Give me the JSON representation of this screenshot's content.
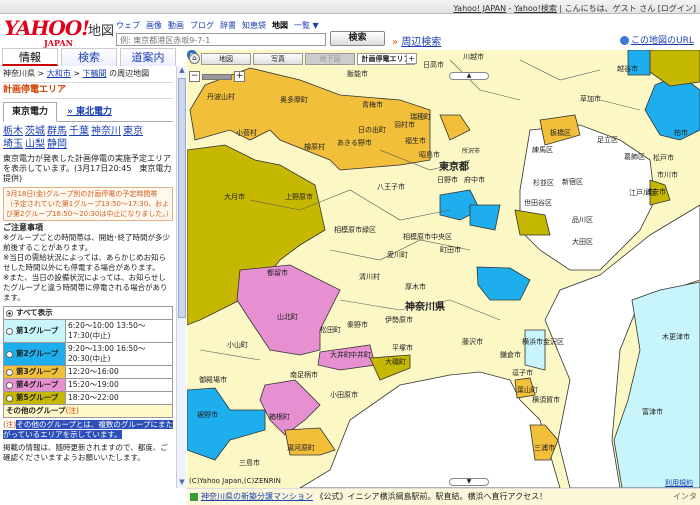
{
  "topbar": {
    "links": [
      "Yahoo! JAPAN",
      "Yahoo!検索"
    ],
    "greeting": "こんにちは、ゲスト さん [ログイン]"
  },
  "header": {
    "logo": "YAHOO!",
    "logo_sub": "JAPAN",
    "service": "地図",
    "nav": [
      "ウェブ",
      "画像",
      "動画",
      "ブログ",
      "辞書",
      "知恵袋",
      "地図",
      "一覧 ▼"
    ],
    "search_placeholder": "例: 東京都港区赤坂9-7-1",
    "search_button": "検索",
    "nearby": "周辺検索",
    "nearby_arrow": "»",
    "map_url": "この地図のURL"
  },
  "tabs": [
    "情報",
    "検索",
    "道案内"
  ],
  "left": {
    "breadcrumb": [
      "神奈川県",
      ">",
      "大和市",
      ">",
      "下鶴間",
      "の周辺地図"
    ],
    "section_title": "計画停電エリア",
    "power_tabs": [
      "東京電力",
      "» 東北電力"
    ],
    "prefectures": [
      "栃木",
      "茨城",
      "群馬",
      "千葉",
      "神奈川",
      "東京",
      "埼玉",
      "山梨",
      "静岡"
    ],
    "description": "東京電力が発表した計画停電の実施予定エリアを表示しています。(3月17日20:45　東京電力提供)",
    "notice": "3月18日(金)グループ別の計画停電の予定時間帯（予定されていた第1グループ13:50～17:30、および第2グループ16:50～20:30は中止になりました。）",
    "caution_title": "ご注意事項",
    "caution": [
      "※グループごとの時間帯は、開始･終了時間が多少前後することがあります。",
      "※当日の需給状況によっては、あらかじめお知らせした時間以外にも停電する場合があります。",
      "※また、当日の設備状況によっては、お知らせしたグループと違う時間帯に停電される場合があります。"
    ],
    "show_all": "すべて表示",
    "groups": [
      {
        "name": "第1グループ",
        "times": "6:20～10:00 13:50～17:30(中止)",
        "color": "#c8f4fb"
      },
      {
        "name": "第2グループ",
        "times": "9:20～13:00 16:50～20:30(中止)",
        "color": "#1eaeed"
      },
      {
        "name": "第3グループ",
        "times": "12:20～16:00",
        "color": "#f2bf3a"
      },
      {
        "name": "第4グループ",
        "times": "15:20～19:00",
        "color": "#e690d2"
      },
      {
        "name": "第5グループ",
        "times": "18:20～22:00",
        "color": "#c6b800"
      }
    ],
    "other_group": "その他のグループ",
    "other_note_link": "(注)",
    "note_label": "(注)",
    "note_text": "その他のグループとは、複数のグループにまたがっているエリアを示しています。",
    "footer_text": "掲載の情報は、随時更新されますので、都度、ご確認くださいますようお願いいたします。"
  },
  "map": {
    "tabs": [
      "地図",
      "写真",
      "地下図",
      "計画停電エリア"
    ],
    "copyright": "(C)Yahoo Japan,(C)ZENRIN",
    "terms": "利用規約",
    "labels": [
      "丹波山村",
      "奥多摩町",
      "青梅市",
      "小菅村",
      "檜原村",
      "あきる野市",
      "日の出町",
      "羽村市",
      "瑞穂町",
      "福生市",
      "昭島市",
      "八王子市",
      "日野市",
      "東京都",
      "大月市",
      "上野原市",
      "都留市",
      "相模原市緑区",
      "相模原市中央区",
      "愛川町",
      "清川村",
      "厚木市",
      "神奈川県",
      "伊勢原市",
      "秦野市",
      "平塚市",
      "山北町",
      "松田町",
      "南足柄市",
      "小田原市",
      "大井町",
      "中井町",
      "大磯町",
      "小山町",
      "御殿場市",
      "裾野市",
      "箱根町",
      "湯河原町",
      "三島市",
      "所沢市",
      "川越市",
      "練馬区",
      "板橋区",
      "足立区",
      "葛飾区",
      "江戸川区",
      "杉並区",
      "新宿区",
      "世田谷区",
      "品川区",
      "大田区",
      "松戸市",
      "柏市",
      "市川市",
      "浦安市",
      "鎌倉市",
      "逗子市",
      "葉山町",
      "横須賀市",
      "三浦市",
      "木更津市",
      "富津市",
      "横浜市金沢区",
      "藤沢市",
      "日高市",
      "飯能市",
      "越谷市",
      "草加市",
      "府中市",
      "町田市"
    ]
  },
  "ad": {
    "link": "神奈川県の新築分譲マンション",
    "text": "《公式》イニシア横浜綱島駅前。駅直結。横浜へ直行アクセス！",
    "right": "インタ"
  }
}
